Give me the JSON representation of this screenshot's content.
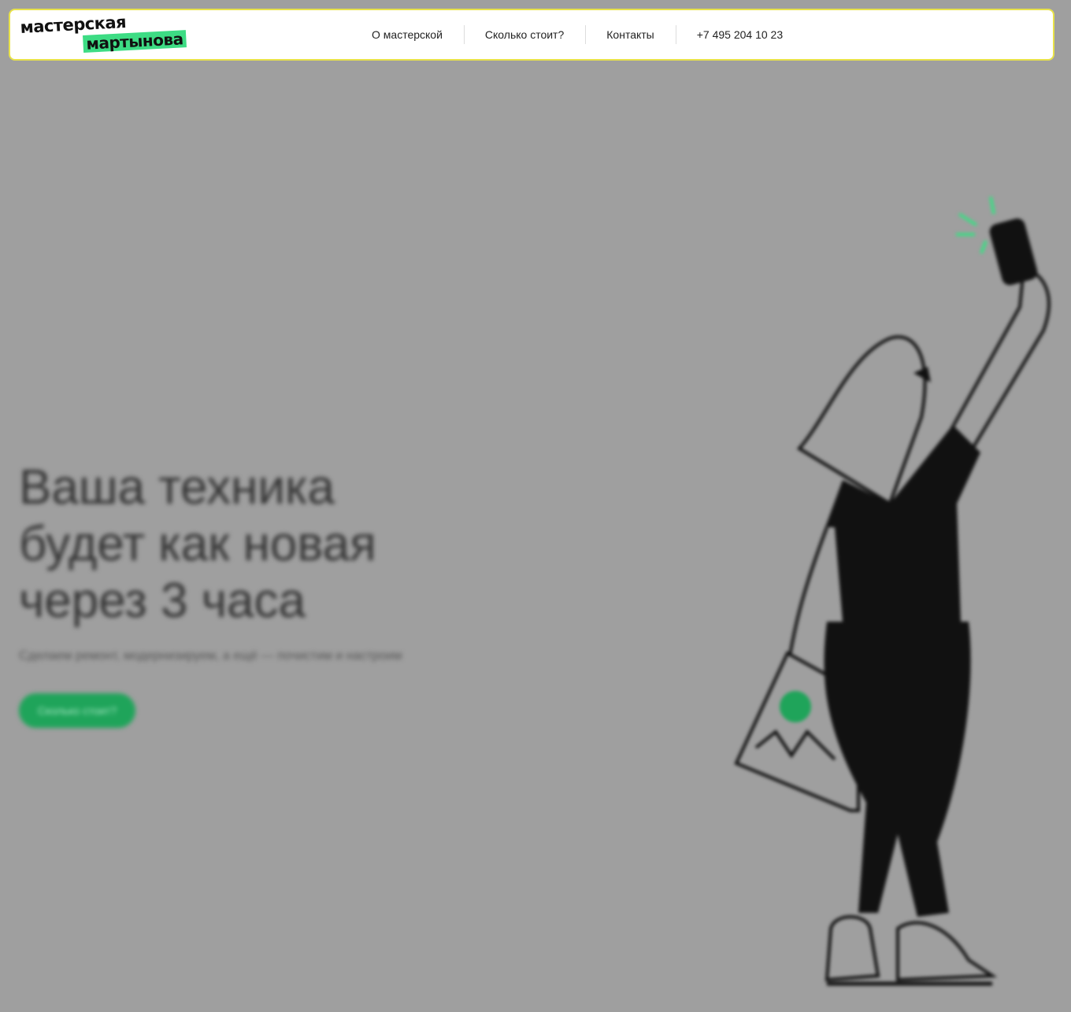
{
  "header": {
    "logo": {
      "line1": "мастерская",
      "line2": "мартынова"
    },
    "nav": [
      {
        "label": "О мастерской"
      },
      {
        "label": "Сколько стоит?"
      },
      {
        "label": "Контакты"
      },
      {
        "label": "+7 495 204 10 23"
      }
    ]
  },
  "hero": {
    "title_lines": [
      "Ваша техника",
      "будет как новая",
      "через 3 часа"
    ],
    "subtitle": "Сделаем ремонт, модернизируем, а ещё — почистим и настроим",
    "cta_label": "Сколько стоит?"
  },
  "colors": {
    "page_background": "#9f9f9f",
    "header_border": "#e8e24a",
    "logo_highlight": "#3ddc84",
    "cta": "#1fa45a"
  }
}
